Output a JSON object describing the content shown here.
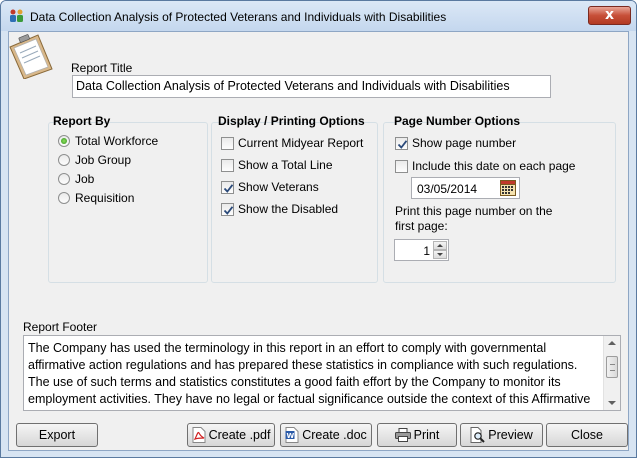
{
  "window": {
    "title": "Data Collection Analysis of Protected Veterans and Individuals with Disabilities",
    "close_label": "x"
  },
  "report_title": {
    "label": "Report Title",
    "value": "Data Collection Analysis of Protected Veterans and Individuals with Disabilities"
  },
  "report_by": {
    "heading": "Report By",
    "options": [
      {
        "label": "Total Workforce",
        "selected": true
      },
      {
        "label": "Job Group",
        "selected": false
      },
      {
        "label": "Job",
        "selected": false
      },
      {
        "label": "Requisition",
        "selected": false
      }
    ]
  },
  "display_options": {
    "heading": "Display / Printing Options",
    "options": [
      {
        "label": "Current Midyear Report",
        "checked": false
      },
      {
        "label": "Show a Total Line",
        "checked": false
      },
      {
        "label": "Show Veterans",
        "checked": true
      },
      {
        "label": "Show the Disabled",
        "checked": true
      }
    ]
  },
  "page_number": {
    "heading": "Page Number Options",
    "show_page_number": {
      "label": "Show page number",
      "checked": true
    },
    "include_date": {
      "label": "Include this date on each page",
      "checked": false
    },
    "date_value": "03/05/2014",
    "first_page_label": "Print this page number on the first page:",
    "first_page_value": "1"
  },
  "footer": {
    "label": "Report Footer",
    "text": "The Company has used the terminology in this report in an effort to comply with governmental affirmative action regulations and has prepared these statistics in compliance with such regulations. The use of such terms and statistics constitutes a good faith effort by the Company to monitor its employment activities. They have no legal or factual significance outside the context of this Affirmative Action Program and in no way suggest any wrong doing by the Company."
  },
  "buttons": {
    "export": "Export",
    "create_pdf": "Create .pdf",
    "create_doc": "Create .doc",
    "print": "Print",
    "preview": "Preview",
    "close": "Close"
  },
  "colors": {
    "title_bg": "#c4d7ee",
    "client_bg": "#f0f0f0",
    "close_red": "#c74f38",
    "check_green": "#2f8f1d"
  }
}
